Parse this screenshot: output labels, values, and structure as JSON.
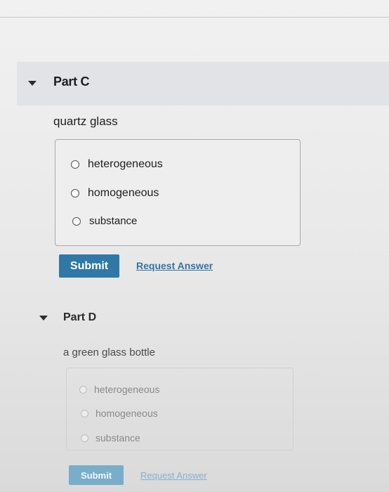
{
  "part_c": {
    "title": "Part C",
    "prompt": "quartz glass",
    "choices": [
      "heterogeneous",
      "homogeneous",
      "substance"
    ],
    "submit_label": "Submit",
    "request_answer_label": "Request Answer"
  },
  "part_d": {
    "title": "Part D",
    "prompt": "a green glass bottle",
    "choices": [
      "heterogeneous",
      "homogeneous",
      "substance"
    ],
    "submit_label": "Submit",
    "request_answer_label": "Request Answer"
  },
  "colors": {
    "submit_button": "#2f78a8",
    "link": "#3572a8",
    "header_band": "#e2e3e6"
  },
  "icons": {
    "collapse_toggle": "chevron-down-icon",
    "radio": "radio-unselected-icon"
  }
}
